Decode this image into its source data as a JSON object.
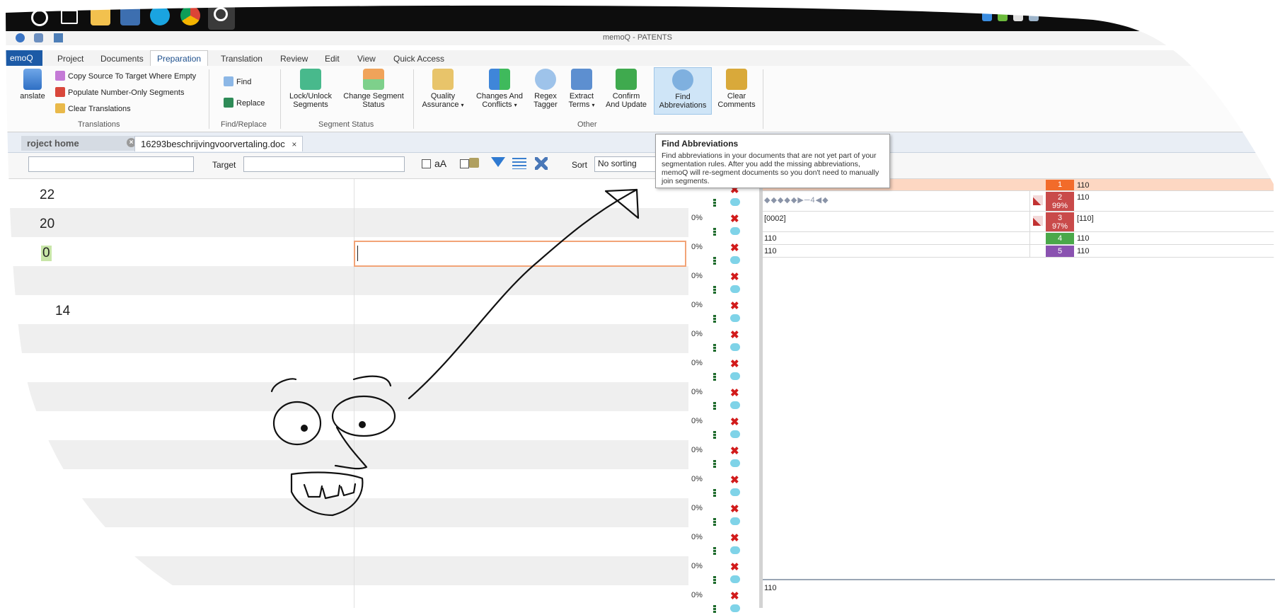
{
  "app_title": "memoQ - PATENTS",
  "ribbon": {
    "app_tab": "emoQ",
    "tabs": [
      "Project",
      "Documents",
      "Preparation",
      "Translation",
      "Review",
      "Edit",
      "View",
      "Quick Access"
    ],
    "active_tab": "Preparation",
    "translations_group": {
      "label": "Translations",
      "translate_label": "anslate",
      "items": [
        "Copy Source To Target Where Empty",
        "Populate Number-Only Segments",
        "Clear Translations"
      ]
    },
    "find_replace_group": {
      "label": "Find/Replace",
      "find": "Find",
      "replace": "Replace"
    },
    "segment_status_group": {
      "label": "Segment Status",
      "lock_line1": "Lock/Unlock",
      "lock_line2": "Segments",
      "change_line1": "Change Segment",
      "change_line2": "Status"
    },
    "other_group": {
      "label": "Other",
      "qa_line1": "Quality",
      "qa_line2": "Assurance",
      "changes_line1": "Changes And",
      "changes_line2": "Conflicts",
      "regex_line1": "Regex",
      "regex_line2": "Tagger",
      "extract_line1": "Extract",
      "extract_line2": "Terms",
      "confirm_line1": "Confirm",
      "confirm_line2": "And Update",
      "find_abbr_line1": "Find",
      "find_abbr_line2": "Abbreviations"
    },
    "clear_comments_line1": "Clear",
    "clear_comments_line2": "Comments"
  },
  "doc_tabs": {
    "project_home": "roject home",
    "document": "16293beschrijvingvoorvertaling.doc"
  },
  "filter_bar": {
    "target_label": "Target",
    "case_label": "aA",
    "sort_label": "Sort",
    "sort_value": "No sorting"
  },
  "tooltip": {
    "title": "Find Abbreviations",
    "body": "Find abbreviations in your documents that are not yet part of your segmentation rules. After you add the missing abbreviations, memoQ will re-segment documents so you don't need to manually join segments."
  },
  "grid": {
    "source_texts": [
      "22",
      "20",
      "0",
      "",
      "14"
    ],
    "percent": "0%"
  },
  "tm_results": {
    "rows": [
      {
        "num": "1",
        "source": "",
        "target": "110",
        "color": "#f26b2a",
        "pct": ""
      },
      {
        "num": "2",
        "source": "◆◆◆◆◆▶─4◀◆",
        "target": "110",
        "color": "#c94a4a",
        "pct": "99%"
      },
      {
        "num": "3",
        "source": "[0002]",
        "target": "[110]",
        "color": "#c94a4a",
        "pct": "97%"
      },
      {
        "num": "4",
        "source": "110",
        "target": "110",
        "color": "#4aa84a",
        "pct": ""
      },
      {
        "num": "5",
        "source": "110",
        "target": "110",
        "color": "#8a52b0",
        "pct": ""
      }
    ],
    "bottom_text": "110"
  },
  "colors": {
    "accent": "#1c5aa6",
    "active_row": "#fdd7c2",
    "edit_border": "#f2a477",
    "reject": "#d21b1b",
    "comment": "#7fd3e8"
  }
}
